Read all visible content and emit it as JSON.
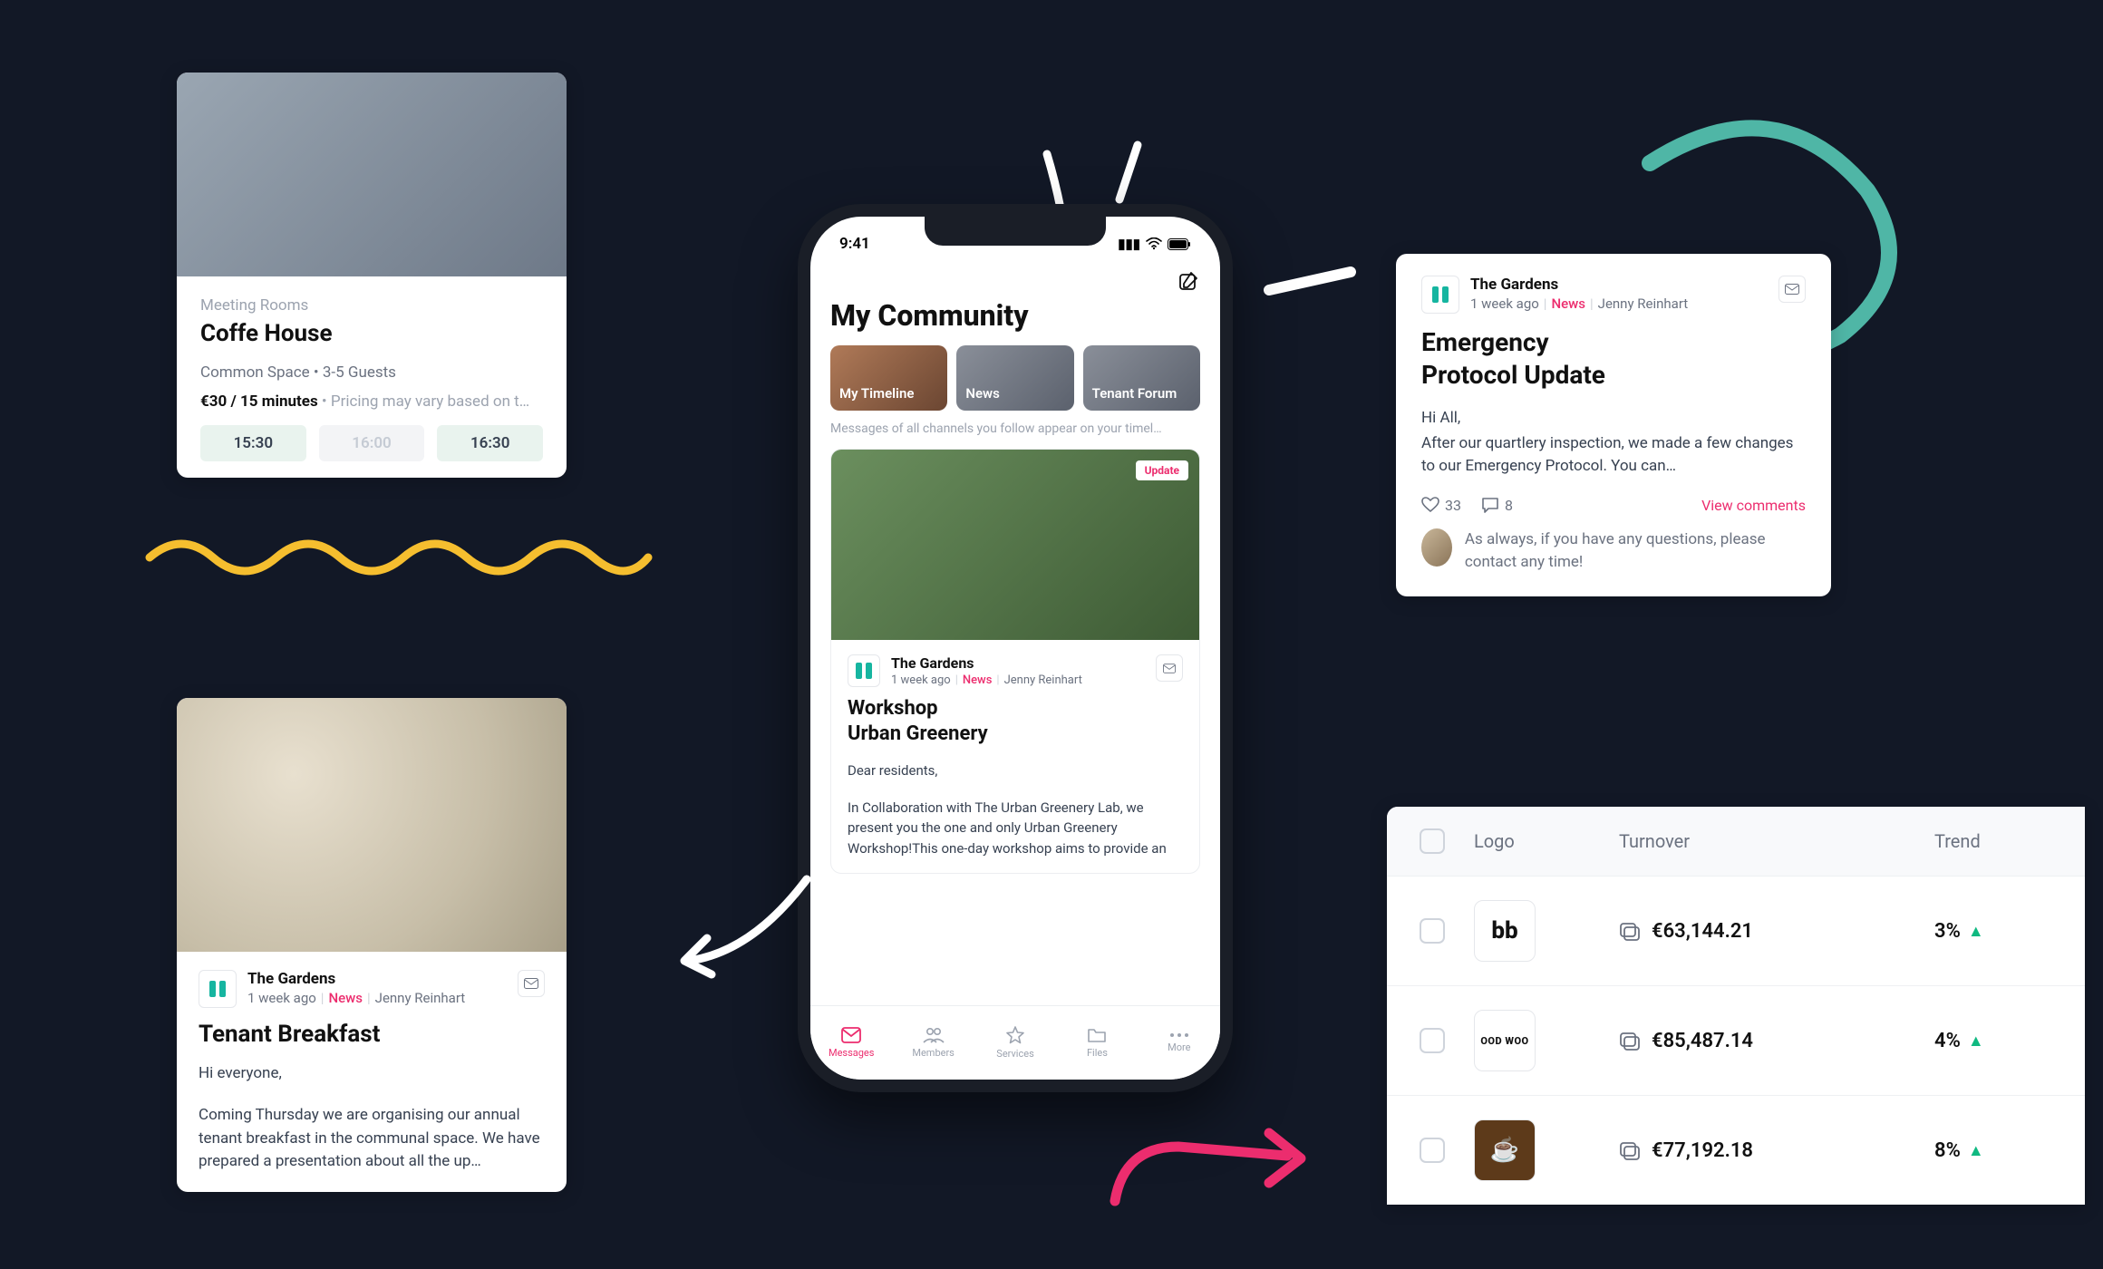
{
  "room": {
    "category": "Meeting Rooms",
    "title": "Coffe House",
    "meta": "Common Space • 3-5 Guests",
    "price": "€30 / 15 minutes",
    "price_note": " • Pricing may vary based on t…",
    "slots": [
      "15:30",
      "16:00",
      "16:30"
    ]
  },
  "breakfast": {
    "source": "The Gardens",
    "age": "1 week ago",
    "channel": "News",
    "author": "Jenny Reinhart",
    "title": "Tenant Breakfast",
    "greeting": "Hi everyone,",
    "body": "Coming Thursday we are organising our annual tenant breakfast in the communal space. We have prepared a presentation about all the up…"
  },
  "phone": {
    "time": "9:41",
    "title": "My Community",
    "tabs": [
      "My Timeline",
      "News",
      "Tenant Forum"
    ],
    "subtitle": "Messages of all channels you follow appear on your timel…",
    "card": {
      "badge": "Update",
      "source": "The Gardens",
      "age": "1 week ago",
      "channel": "News",
      "author": "Jenny Reinhart",
      "title_l1": "Workshop",
      "title_l2": "Urban Greenery",
      "greeting": "Dear residents,",
      "body": "In Collaboration with The Urban Greenery Lab, we present you the one and only Urban Greenery Workshop!This one-day workshop aims to provide an"
    },
    "nav": [
      "Messages",
      "Members",
      "Services",
      "Files",
      "More"
    ]
  },
  "emergency": {
    "source": "The Gardens",
    "age": "1 week ago",
    "channel": "News",
    "author": "Jenny Reinhart",
    "title_l1": "Emergency",
    "title_l2": "Protocol Update",
    "greeting": "Hi All,",
    "body": "After our quartlery inspection, we made a few changes to our Emergency Protocol. You can…",
    "likes": "33",
    "comments": "8",
    "view_comments": "View comments",
    "comment": "As always, if you have any questions, please contact any time!"
  },
  "table": {
    "headers": {
      "logo": "Logo",
      "turnover": "Turnover",
      "trend": "Trend"
    },
    "rows": [
      {
        "logo": "bb",
        "turnover": "€63,144.21",
        "trend": "3%"
      },
      {
        "logo": "OOD WOO",
        "turnover": "€85,487.14",
        "trend": "4%"
      },
      {
        "logo": "☕",
        "turnover": "€77,192.18",
        "trend": "8%"
      }
    ]
  }
}
